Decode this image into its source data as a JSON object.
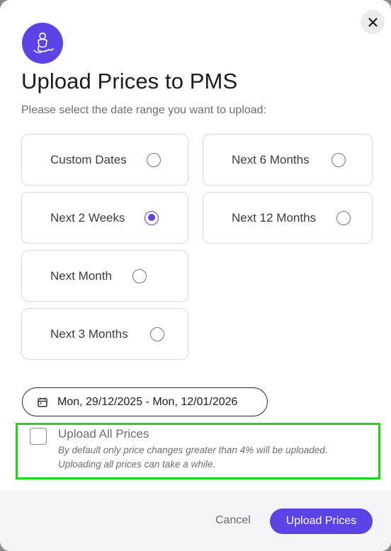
{
  "dialog": {
    "title": "Upload Prices to PMS",
    "subtitle": "Please select the date range you want to upload:"
  },
  "colors": {
    "accent": "#5b44e6",
    "highlight_border": "#22d41a"
  },
  "date_options": [
    {
      "label": "Custom Dates",
      "selected": false
    },
    {
      "label": "Next 2 Weeks",
      "selected": true
    },
    {
      "label": "Next Month",
      "selected": false
    },
    {
      "label": "Next 3 Months",
      "selected": false
    },
    {
      "label": "Next 6 Months",
      "selected": false
    },
    {
      "label": "Next 12 Months",
      "selected": false
    }
  ],
  "date_range": {
    "icon": "calendar-icon",
    "text": "Mon, 29/12/2025 - Mon, 12/01/2026"
  },
  "upload_all": {
    "checked": false,
    "label": "Upload All Prices",
    "description_line1": "By default only price changes greater than 4% will be uploaded.",
    "description_line2": "Uploading all prices can take a while."
  },
  "footer": {
    "cancel_label": "Cancel",
    "upload_label": "Upload Prices"
  },
  "icons": {
    "close": "close-icon",
    "avatar": "genie-icon"
  }
}
